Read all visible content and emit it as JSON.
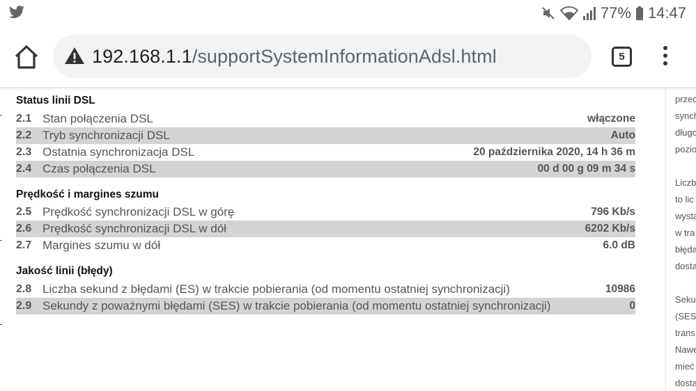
{
  "status_bar": {
    "app_icon": "twitter-bird-icon",
    "battery": "77%",
    "time": "14:47",
    "icons": [
      "mute-icon",
      "wifi-icon",
      "signal-icon",
      "battery-icon"
    ]
  },
  "browser": {
    "url_host": "192.168.1.1",
    "url_path": "/supportSystemInformationAdsl.html",
    "security_icon": "warning-triangle-icon",
    "tab_count": "5"
  },
  "sections": [
    {
      "title": "Status linii DSL",
      "rows": [
        {
          "num": "2.1",
          "label": "Stan połączenia DSL",
          "value": "włączone"
        },
        {
          "num": "2.2",
          "label": "Tryb synchronizacji DSL",
          "value": "Auto"
        },
        {
          "num": "2.3",
          "label": "Ostatnia synchronizacja DSL",
          "value": "20 października 2020, 14 h 36 m"
        },
        {
          "num": "2.4",
          "label": "Czas połączenia DSL",
          "value": "00 d 00 g 09 m 34 s"
        }
      ]
    },
    {
      "title": "Prędkość i margines szumu",
      "rows": [
        {
          "num": "2.5",
          "label": "Prędkość synchronizacji DSL w górę",
          "value": "796 Kb/s"
        },
        {
          "num": "2.6",
          "label": "Prędkość synchronizacji DSL w dół",
          "value": "6202 Kb/s"
        },
        {
          "num": "2.7",
          "label": "Margines szumu w dół",
          "value": "6.0 dB"
        }
      ]
    },
    {
      "title": "Jakość linii (błędy)",
      "rows": [
        {
          "num": "2.8",
          "label": "Liczba sekund z błędami (ES) w trakcie pobierania (od momentu ostatniej synchronizacji)",
          "value": "10986"
        },
        {
          "num": "2.9",
          "label": "Sekundy z poważnymi błędami (SES) w trakcie pobierania (od momentu ostatniej synchronizacji)",
          "value": "0"
        }
      ]
    }
  ],
  "side_panel": {
    "lines": [
      "przed",
      "synch",
      "długo",
      "pozio",
      "Liczb",
      "to lic",
      "wysta",
      "w tra",
      "błęda",
      "dosta",
      "Seku",
      "(SES)",
      "trans",
      "Nawe",
      "mieć",
      "dosta"
    ]
  }
}
